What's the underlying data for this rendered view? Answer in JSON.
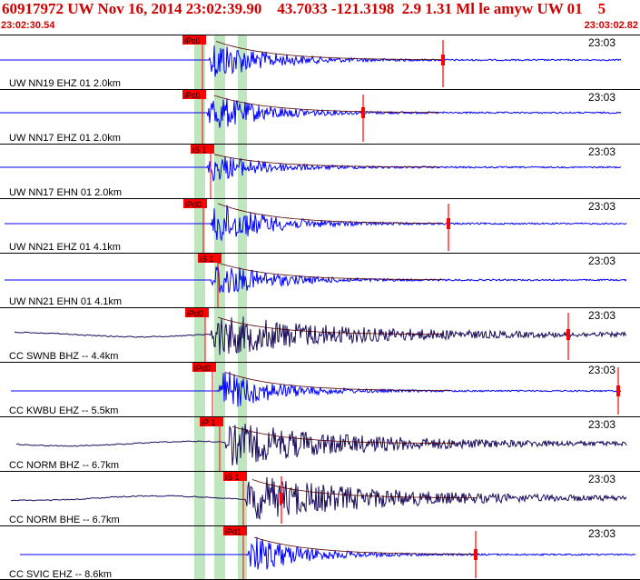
{
  "header": {
    "title": "60917972 UW Nov 16, 2014 23:02:39.90    43.7033 -121.3198  2.9 1.31 Ml le amyw UW 01    5",
    "start_time": "23:02:30.54",
    "end_time": "23:03:02.82"
  },
  "colors": {
    "header_text": "#d00000",
    "trace_blue": "#0000ff",
    "trace_navy": "#1a0a5a",
    "pick_red": "#ff0000",
    "band_green": "#bfe6bf"
  },
  "channels": [
    {
      "label": "UW NN19 EHZ 01 2.0km",
      "time_label": "23:03",
      "pick": "iPc0",
      "style": "blue"
    },
    {
      "label": "UW NN17 EHZ 01 2.0km",
      "time_label": "23:03",
      "pick": "iPc0",
      "style": "blue"
    },
    {
      "label": "UW NN17 EHN 01 2.0km",
      "time_label": "23:03",
      "pick": "iS 1",
      "style": "blue"
    },
    {
      "label": "UW NN21 EHZ 01 4.1km",
      "time_label": "23:03",
      "pick": "iPd0",
      "style": "blue"
    },
    {
      "label": "UW NN21 EHN 01 4.1km",
      "time_label": "23:03",
      "pick": "iS 1",
      "style": "blue"
    },
    {
      "label": "CC SWNB BHZ -- 4.4km",
      "time_label": "23:03",
      "pick": "iPd0",
      "style": "navy"
    },
    {
      "label": "CC KWBU EHZ -- 5.5km",
      "time_label": "23:03",
      "pick": "iPd0",
      "style": "blue"
    },
    {
      "label": "CC NORM BHZ -- 6.7km",
      "time_label": "23:03",
      "pick": "iP 1",
      "style": "navy"
    },
    {
      "label": "CC NORM BHE -- 6.7km",
      "time_label": "23:03",
      "pick": "iS 1",
      "style": "navy"
    },
    {
      "label": "CC SVIC EHZ -- 8.6km",
      "time_label": "23:03",
      "pick": "iPd1",
      "style": "blue"
    }
  ]
}
